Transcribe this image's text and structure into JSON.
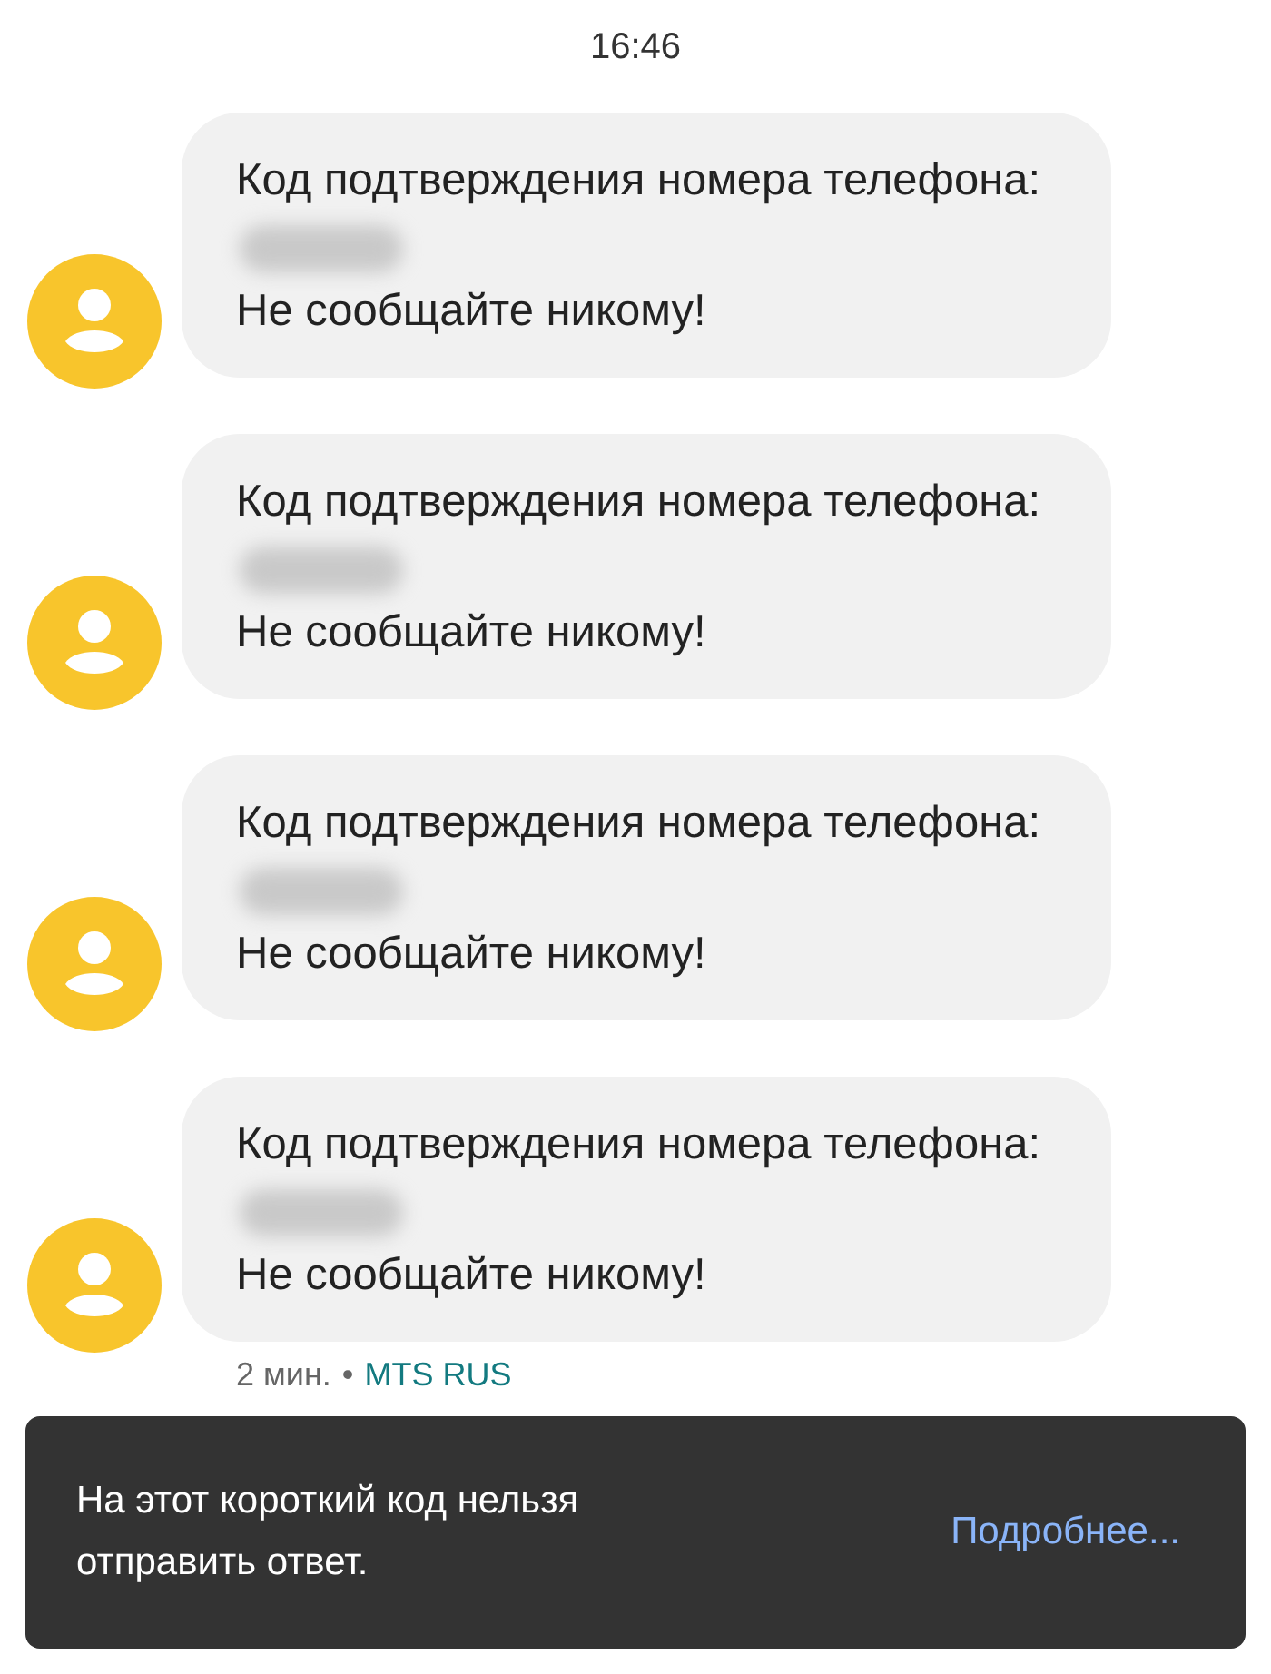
{
  "time": "16:46",
  "messages": [
    {
      "text": "Код подтверждения номера телефона:",
      "code_hidden": true,
      "warning": "Не сообщайте никому!"
    },
    {
      "text": "Код подтверждения номера телефона:",
      "code_hidden": true,
      "warning": "Не сообщайте никому!"
    },
    {
      "text": "Код подтверждения номера телефона:",
      "code_hidden": true,
      "warning": "Не сообщайте никому!"
    },
    {
      "text": "Код подтверждения номера телефона:",
      "code_hidden": true,
      "warning": "Не сообщайте никому!"
    }
  ],
  "footer": {
    "age": "2 мин.",
    "separator": "•",
    "sender": "MTS RUS"
  },
  "snackbar": {
    "message": "На этот короткий код нельзя отправить ответ.",
    "action": "Подробнее..."
  }
}
